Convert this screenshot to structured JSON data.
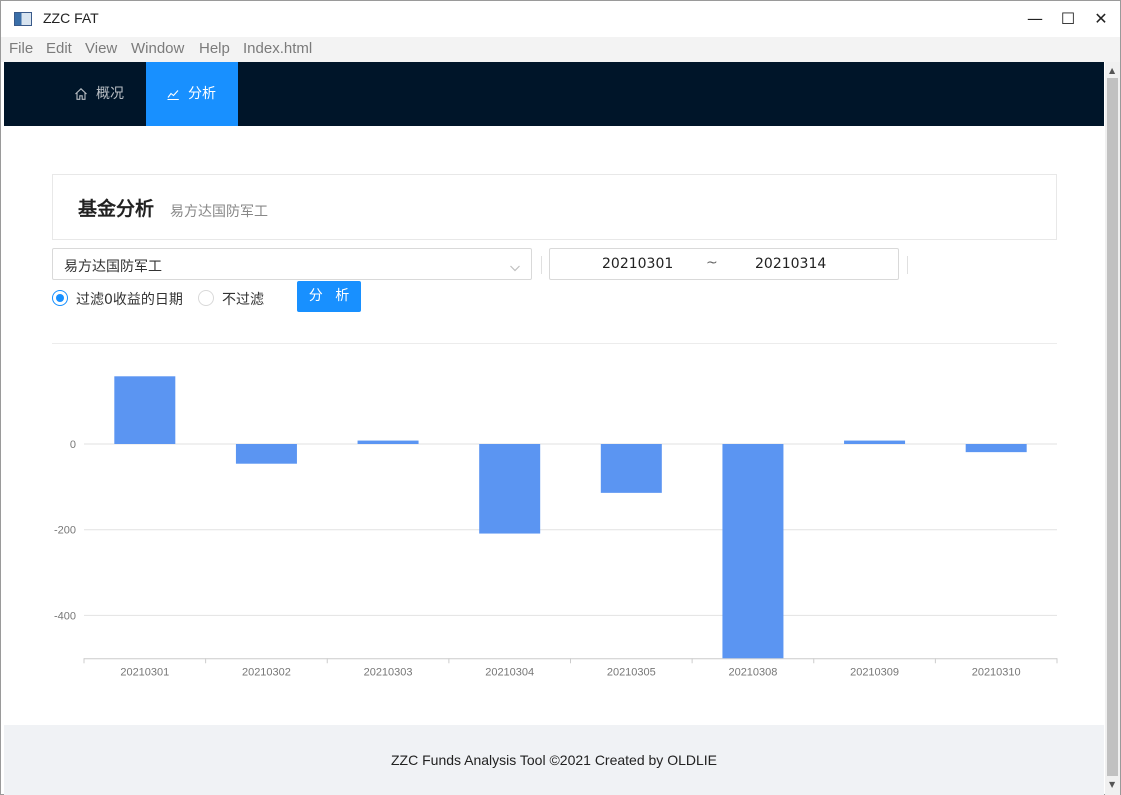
{
  "window": {
    "title": "ZZC FAT",
    "minimize": "—",
    "maximize": "☐",
    "close": "✕"
  },
  "menu": [
    "File",
    "Edit",
    "View",
    "Window",
    "Help",
    "Index.html"
  ],
  "nav": {
    "items": [
      {
        "label": "概况",
        "icon": "home-icon",
        "active": false
      },
      {
        "label": "分析",
        "icon": "line-chart-icon",
        "active": true
      }
    ]
  },
  "header": {
    "title": "基金分析",
    "subtitle": "易方达国防军工"
  },
  "form": {
    "fund_select": "易方达国防军工",
    "date_start": "20210301",
    "date_sep": "~",
    "date_end": "20210314",
    "radio_filter": "过滤0收益的日期",
    "radio_nofilter": "不过滤",
    "radio_selected": "filter",
    "analyze_button": "分 析"
  },
  "chart_data": {
    "type": "bar",
    "categories": [
      "20210301",
      "20210302",
      "20210303",
      "20210304",
      "20210305",
      "20210308",
      "20210309",
      "20210310"
    ],
    "values": [
      158,
      -46,
      8,
      -209,
      -114,
      -500,
      8,
      -19
    ],
    "ylim": [
      -500,
      160
    ],
    "yticks": [
      0,
      -200,
      -400
    ],
    "ytick_labels": [
      "0",
      "-200",
      "-400"
    ],
    "grid": true,
    "bar_color": "#5b95f2"
  },
  "footer": {
    "text": "ZZC Funds Analysis Tool ©2021 Created by OLDLIE"
  }
}
